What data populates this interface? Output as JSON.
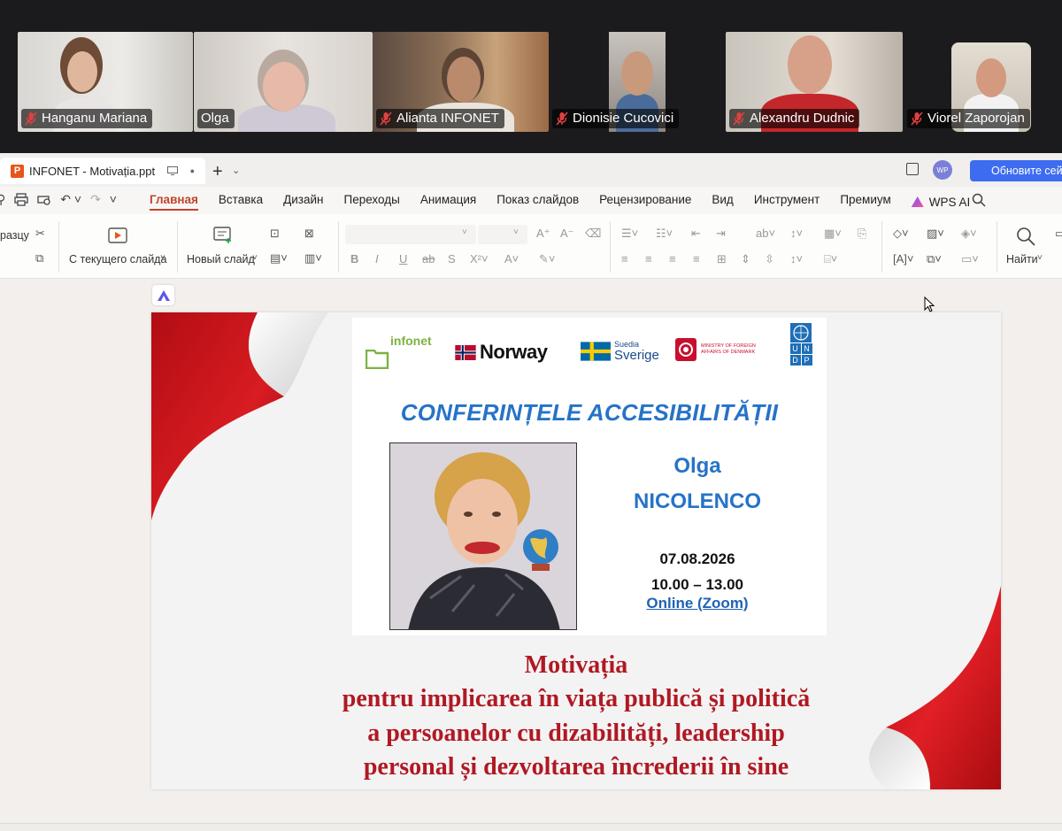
{
  "zoom": {
    "participants": [
      {
        "name": "Hanganu Mariana",
        "muted": true,
        "active": false
      },
      {
        "name": "Olga",
        "muted": false,
        "active": true
      },
      {
        "name": "Alianta INFONET",
        "muted": true,
        "active": false
      },
      {
        "name": "Dionisie Cucovici",
        "muted": true,
        "active": false
      },
      {
        "name": "Alexandru Dudnic",
        "muted": true,
        "active": false
      },
      {
        "name": "Viorel Zaporojan",
        "muted": true,
        "active": false
      }
    ]
  },
  "app": {
    "tab_title": "INFONET - Motivația.ppt",
    "update_button": "Обновите сейчас",
    "user_avatar": "WP"
  },
  "menu": {
    "items": [
      "Главная",
      "Вставка",
      "Дизайн",
      "Переходы",
      "Анимация",
      "Показ слайдов",
      "Рецензирование",
      "Вид",
      "Инструмент",
      "Премиум"
    ],
    "active": "Главная",
    "wps_ai": "WPS AI"
  },
  "ribbon": {
    "format_painter_label": "разцу",
    "from_current_slide": "С текущего слайда",
    "new_slide": "Новый слайд",
    "find": "Найти"
  },
  "slide": {
    "logos": {
      "infonet": "infonet",
      "norway": "Norway",
      "sweden_top": "Suedia",
      "sweden_bottom": "Sverige",
      "denmark": "MINISTRY OF FOREIGN AFFAIRS OF DENMARK",
      "undp_letters": [
        "U",
        "N",
        "D",
        "P"
      ]
    },
    "title": "CONFERINȚELE ACCESIBILITĂȚII",
    "speaker_first": "Olga",
    "speaker_last": "NICOLENCO",
    "date": "07.08.2026",
    "time": "10.00 – 13.00",
    "online": "Online (Zoom)",
    "headline": [
      "Motivația",
      "pentru implicarea în viața publică și politică",
      "a persoanelor cu dizabilități, leadership",
      "personal și dezvoltarea încrederii în sine"
    ]
  },
  "colors": {
    "accent_red": "#c2442d",
    "speaker_blue": "#2673c7",
    "headline_red": "#b01922",
    "active_speaker_border": "#23d95c",
    "update_blue": "#3d6cf0"
  }
}
